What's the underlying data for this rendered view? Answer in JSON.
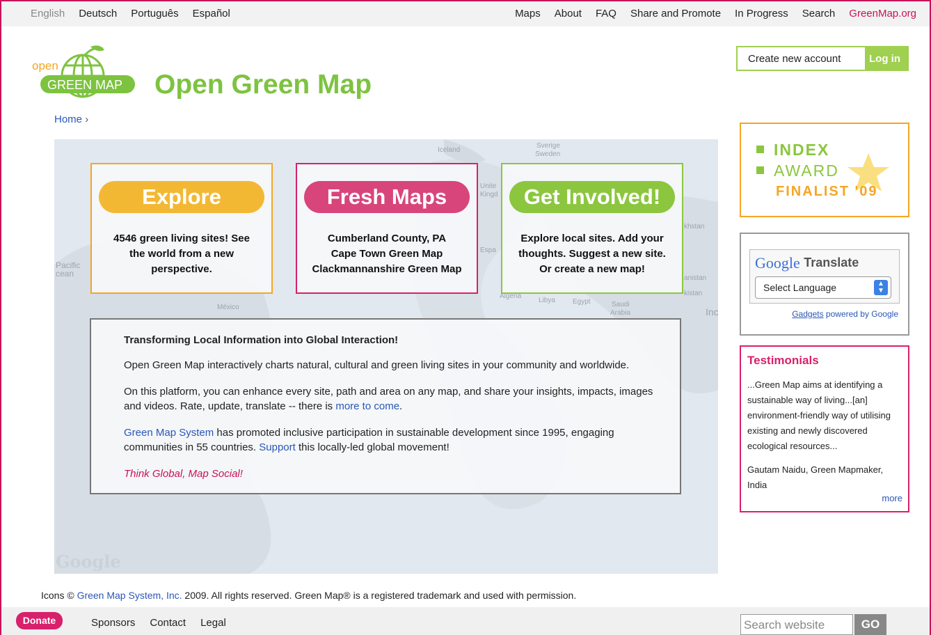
{
  "topbar": {
    "languages": [
      "English",
      "Deutsch",
      "Português",
      "Español"
    ],
    "nav": [
      "Maps",
      "About",
      "FAQ",
      "Share and Promote",
      "In Progress",
      "Search",
      "GreenMap.org"
    ]
  },
  "logo": {
    "word_open": "open",
    "word_main": "GREEN MAP"
  },
  "site_title": "Open Green Map",
  "breadcrumb": {
    "home": "Home",
    "sep": "›"
  },
  "account": {
    "create": "Create new account",
    "login": "Log in"
  },
  "map_labels": {
    "iceland": "Iceland",
    "sverige": "Sverige",
    "sweden": "Sweden",
    "united": "Unite",
    "kingdom": "Kingd",
    "espana": "Espa",
    "pacific": "Pacific",
    "ocean": "cean",
    "mexico": "México",
    "algeria": "Algeria",
    "libya": "Libya",
    "egypt": "Egypt",
    "saudi": "Saudi",
    "arabia": "Arabia",
    "india": "Inc",
    "kazakhstan": "khstan",
    "afghanistan": "anistan",
    "pakistan": "kistan",
    "google": "Google"
  },
  "cards": [
    {
      "title": "Explore",
      "color": "#f3b833",
      "border": "#f5a623",
      "lines": [
        "4546 green living sites! See",
        "the world from a new",
        "perspective."
      ]
    },
    {
      "title": "Fresh Maps",
      "color": "#d8457a",
      "border": "#d8206b",
      "lines": [
        "Cumberland County, PA",
        "Cape Town Green Map",
        "Clackmannanshire Green Map"
      ]
    },
    {
      "title": "Get Involved!",
      "color": "#8cc63f",
      "border": "#8cc63f",
      "lines": [
        "Explore local sites. Add your",
        "thoughts. Suggest a new site.",
        "Or create a new map!"
      ]
    }
  ],
  "info": {
    "heading": "Transforming Local Information into Global Interaction!",
    "p1": "Open Green Map interactively charts natural, cultural and green living sites in your community and worldwide.",
    "p2_text": "On this platform, you can enhance every site, path and area on any map, and share your insights, impacts, images and videos. Rate, update, translate -- there is ",
    "p2_link": "more to come",
    "p2_end": ".",
    "p3_link1": "Green Map System",
    "p3_text1": " has promoted inclusive participation in sustainable development since 1995, engaging communities in 55 countries. ",
    "p3_link2": "Support",
    "p3_text2": " this locally-led global movement!",
    "slogan": "Think Global, Map Social!"
  },
  "award": {
    "line1": "INDEX",
    "line2": "AWARD",
    "line3": "FINALIST '09"
  },
  "translate": {
    "brand": "Google",
    "word": "Translate",
    "select": "Select Language",
    "gadgets": "Gadgets",
    "powered": " powered by Google"
  },
  "testimonials": {
    "title": "Testimonials",
    "quote": "...Green Map aims at identifying a sustainable way of living...[an] environment-friendly way of utilising existing and newly discovered ecological resources...",
    "author": "Gautam Naidu, Green Mapmaker, India",
    "more": "more"
  },
  "copyright": {
    "pre": "Icons © ",
    "link": "Green Map System, Inc.",
    "post": " 2009. All rights reserved. Green Map® is a registered trademark and used with permission."
  },
  "footer": {
    "donate": "Donate",
    "links": [
      "Sponsors",
      "Contact",
      "Legal"
    ],
    "search_placeholder": "Search website",
    "go": "GO"
  }
}
